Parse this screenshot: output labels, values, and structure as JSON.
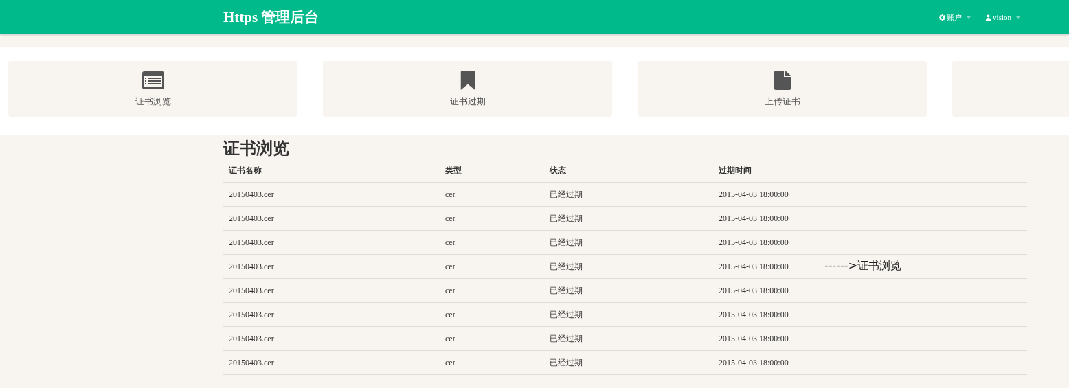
{
  "header": {
    "brand": "Https 管理后台",
    "menus": [
      {
        "kind": "gear",
        "label": "账户"
      },
      {
        "kind": "user",
        "label": "vision"
      }
    ]
  },
  "nav_cards": [
    {
      "kind": "list",
      "label": "证书浏览"
    },
    {
      "kind": "bookmark",
      "label": "证书过期"
    },
    {
      "kind": "file",
      "label": "上传证书"
    },
    {
      "kind": "empty"
    }
  ],
  "page_title": "证书浏览",
  "table": {
    "columns": [
      "证书名称",
      "类型",
      "状态",
      "过期时间"
    ],
    "rows": [
      [
        "20150403.cer",
        "cer",
        "已经过期",
        "2015-04-03 18:00:00"
      ],
      [
        "20150403.cer",
        "cer",
        "已经过期",
        "2015-04-03 18:00:00"
      ],
      [
        "20150403.cer",
        "cer",
        "已经过期",
        "2015-04-03 18:00:00"
      ],
      [
        "20150403.cer",
        "cer",
        "已经过期",
        "2015-04-03 18:00:00"
      ],
      [
        "20150403.cer",
        "cer",
        "已经过期",
        "2015-04-03 18:00:00"
      ],
      [
        "20150403.cer",
        "cer",
        "已经过期",
        "2015-04-03 18:00:00"
      ],
      [
        "20150403.cer",
        "cer",
        "已经过期",
        "2015-04-03 18:00:00"
      ],
      [
        "20150403.cer",
        "cer",
        "已经过期",
        "2015-04-03 18:00:00"
      ]
    ]
  },
  "annotation": "------>证书浏览"
}
